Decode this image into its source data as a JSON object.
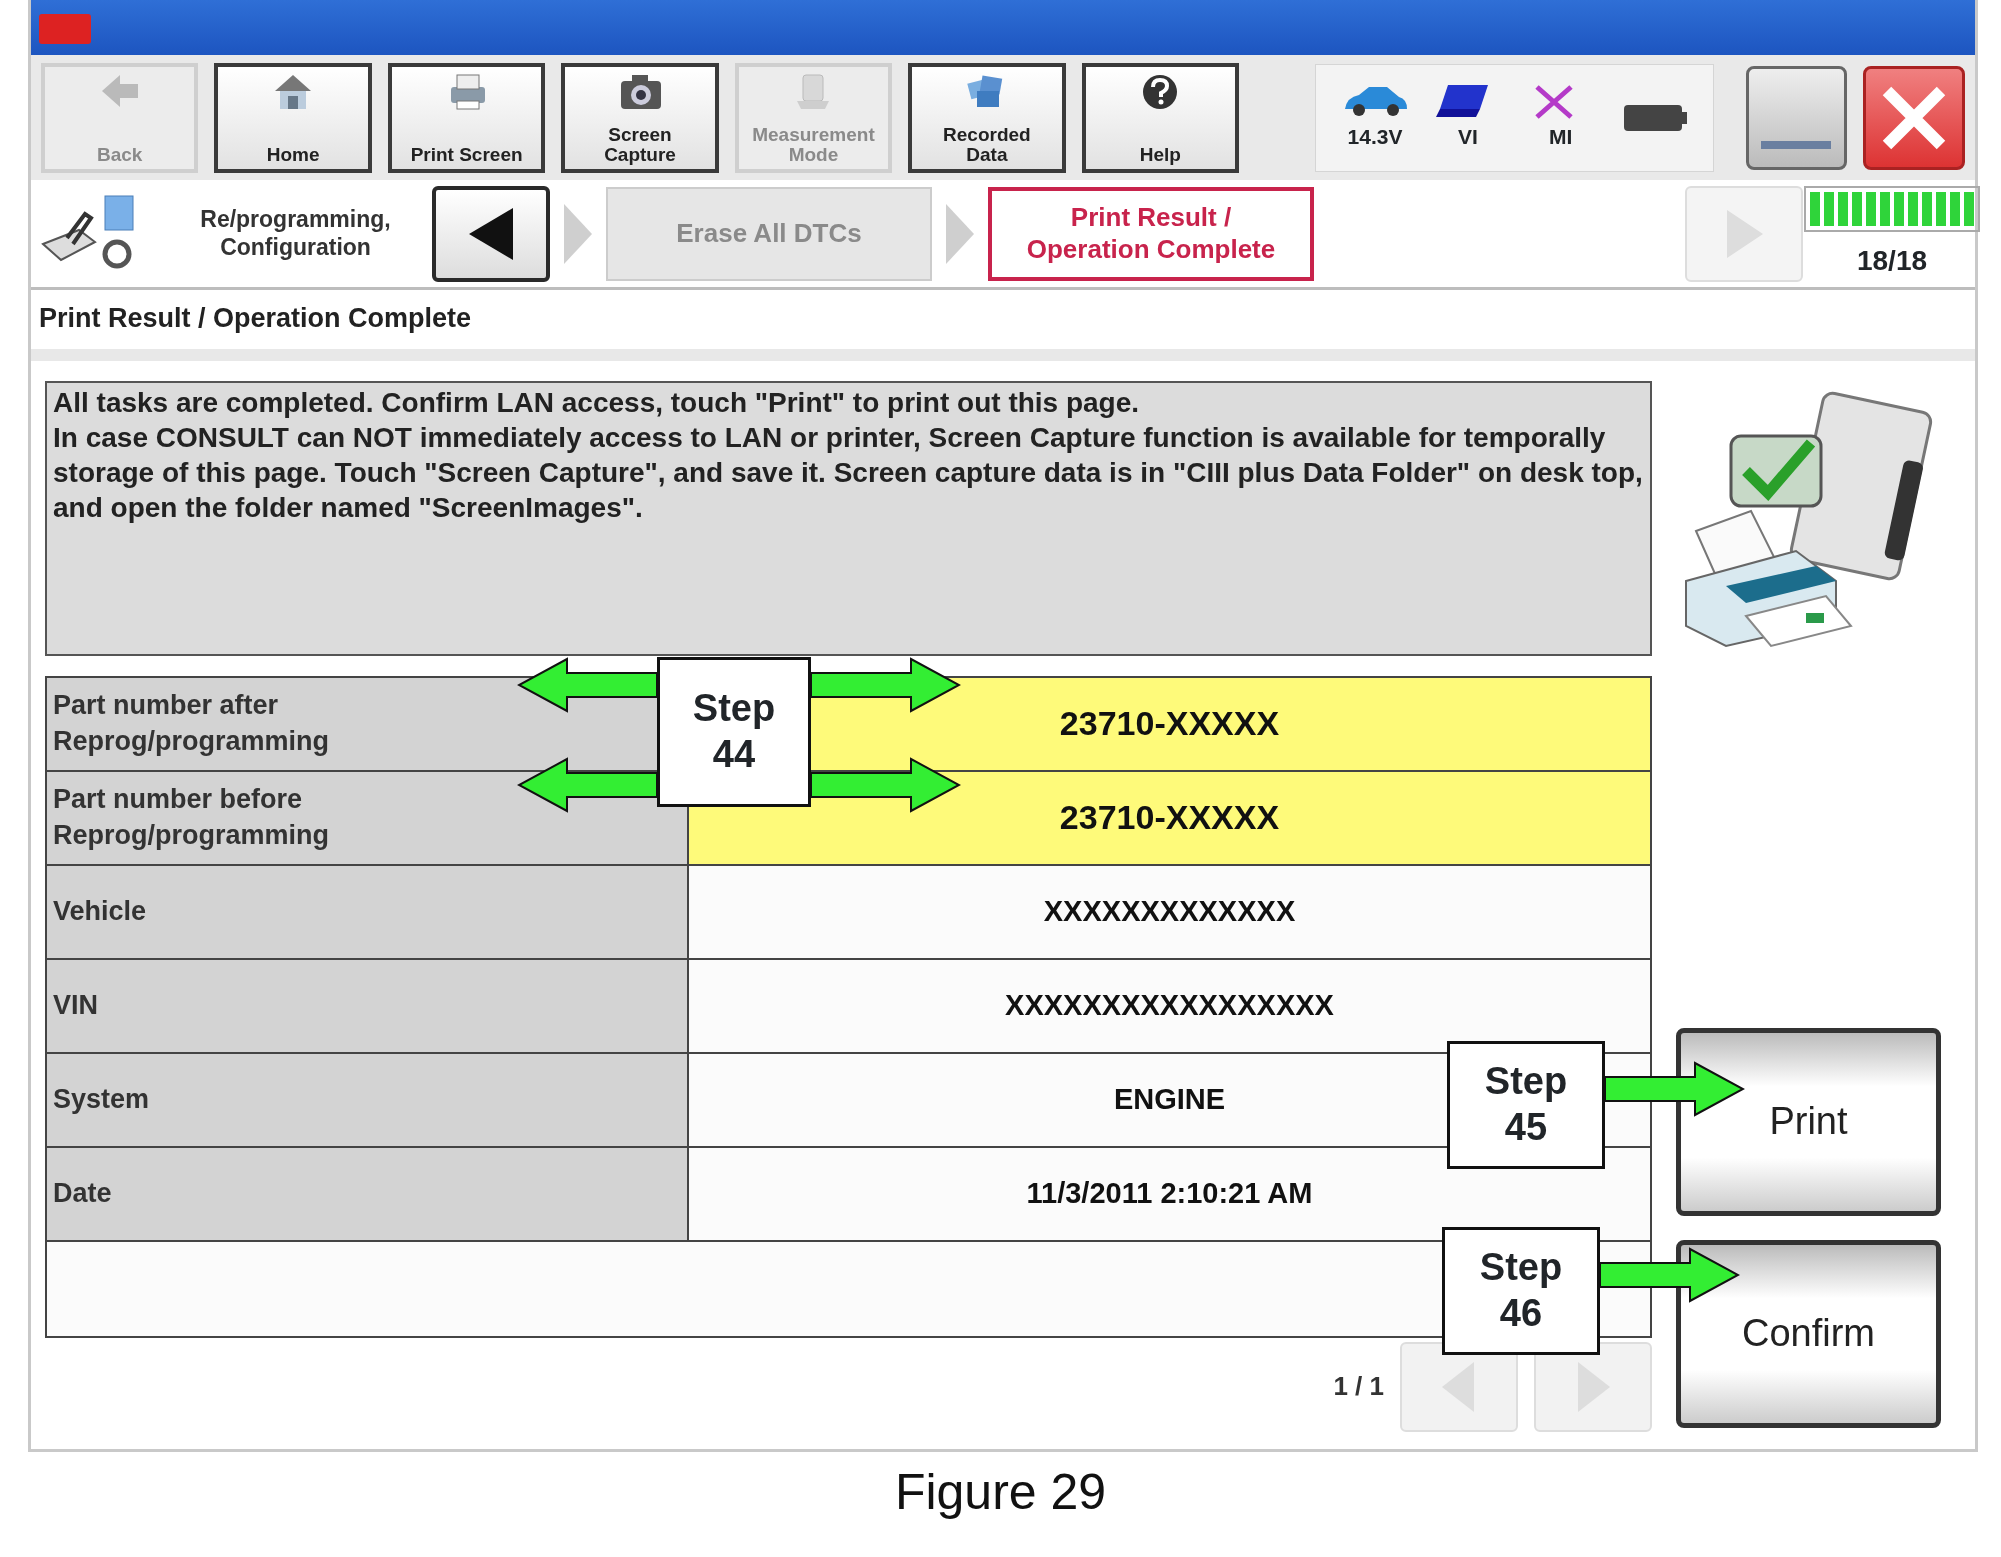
{
  "toolbar": {
    "buttons": [
      {
        "label": "Back",
        "kind": "back",
        "disabled": true
      },
      {
        "label": "Home",
        "kind": "home",
        "disabled": false
      },
      {
        "label": "Print Screen",
        "kind": "printer",
        "disabled": false
      },
      {
        "label": "Screen Capture",
        "kind": "camera",
        "disabled": false
      },
      {
        "label": "Measurement Mode",
        "kind": "meter",
        "disabled": true
      },
      {
        "label": "Recorded Data",
        "kind": "folders",
        "disabled": false
      },
      {
        "label": "Help",
        "kind": "help",
        "disabled": false
      }
    ],
    "status": [
      {
        "label": "14.3V",
        "kind": "car"
      },
      {
        "label": "VI",
        "kind": "vi"
      },
      {
        "label": "MI",
        "kind": "mi"
      },
      {
        "kind": "battery"
      }
    ]
  },
  "breadcrumb": {
    "section": "Re/programming, Configuration",
    "steps": [
      {
        "label": "Erase All DTCs",
        "selected": false
      },
      {
        "label": "Print Result / Operation Complete",
        "selected": true
      }
    ],
    "progress": {
      "level": 1,
      "reading": "18/18"
    }
  },
  "page_title": "Print Result / Operation Complete",
  "message": [
    "All tasks are completed. Confirm LAN access, touch \"Print\" to print out this page.",
    "In case CONSULT can NOT immediately access to LAN or printer, Screen Capture function is available for temporally storage of this page. Touch \"Screen Capture\", and save it. Screen capture data is in \"CIII plus Data Folder\" on desk top, and open the folder named \"ScreenImages\"."
  ],
  "results": [
    {
      "label": "Part number after Reprog/programming",
      "value": "23710-XXXXX",
      "highlighted": true
    },
    {
      "label": "Part number before Reprog/programming",
      "value": "23710-XXXXX",
      "highlighted": true
    },
    {
      "label": "Vehicle",
      "value": "XXXXXXXXXXXXX",
      "highlighted": false
    },
    {
      "label": "VIN",
      "value": "XXXXXXXXXXXXXXXXX",
      "highlighted": false
    },
    {
      "label": "System",
      "value": "ENGINE",
      "highlighted": false
    },
    {
      "label": "Date",
      "value": "11/3/2011 2:10:21 AM",
      "highlighted": false
    }
  ],
  "callouts": [
    {
      "text": "Step 44",
      "kind": "double"
    },
    {
      "text": "Step 45",
      "kind": "right"
    },
    {
      "text": "Step 46",
      "kind": "right"
    }
  ],
  "actions": [
    "Print",
    "Confirm"
  ],
  "pager": "1 / 1",
  "caption": "Figure 29"
}
